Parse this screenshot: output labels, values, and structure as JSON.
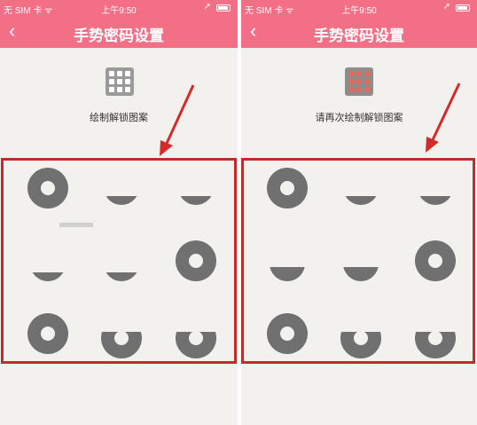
{
  "screens": [
    {
      "status": {
        "carrier": "无 SIM 卡 ᯤ",
        "time": "上午9:50"
      },
      "nav": {
        "back_glyph": "‹",
        "title": "手势密码设置"
      },
      "hint": "绘制解锁图案"
    },
    {
      "status": {
        "carrier": "无 SIM 卡 ᯤ",
        "time": "上午9:50"
      },
      "nav": {
        "back_glyph": "‹",
        "title": "手势密码设置"
      },
      "hint": "请再次绘制解锁图案"
    }
  ],
  "colors": {
    "accent": "#f36f86",
    "highlight_border": "#c22b2b",
    "annotation_arrow": "#d42a2a",
    "dot": "#707070",
    "background": "#f3f1ee"
  },
  "icons": {
    "grid": "grid-icon",
    "back": "back-arrow-icon",
    "battery": "battery-icon",
    "location": "location-arrow-icon"
  }
}
